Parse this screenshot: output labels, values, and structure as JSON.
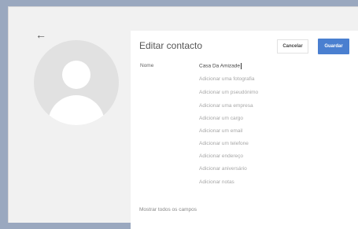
{
  "header": {
    "title": "Editar contacto"
  },
  "actions": {
    "cancel_label": "Cancelar",
    "save_label": "Guardar"
  },
  "form": {
    "name_label": "Nome",
    "name_value": "Casa Da Amizade",
    "fields": [
      "Adicionar uma fotografia",
      "Adicionar um pseudónimo",
      "Adicionar uma empresa",
      "Adicionar um cargo",
      "Adicionar um email",
      "Adicionar um telefone",
      "Adicionar endereço",
      "Adicionar aniversário",
      "Adicionar notas"
    ],
    "show_all_label": "Mostrar todos os campos"
  },
  "icons": {
    "back": "arrow-left-icon",
    "avatar": "person-placeholder-icon"
  },
  "colors": {
    "accent": "#4a7fd0",
    "background": "#f1f1f1",
    "card": "#ffffff"
  }
}
